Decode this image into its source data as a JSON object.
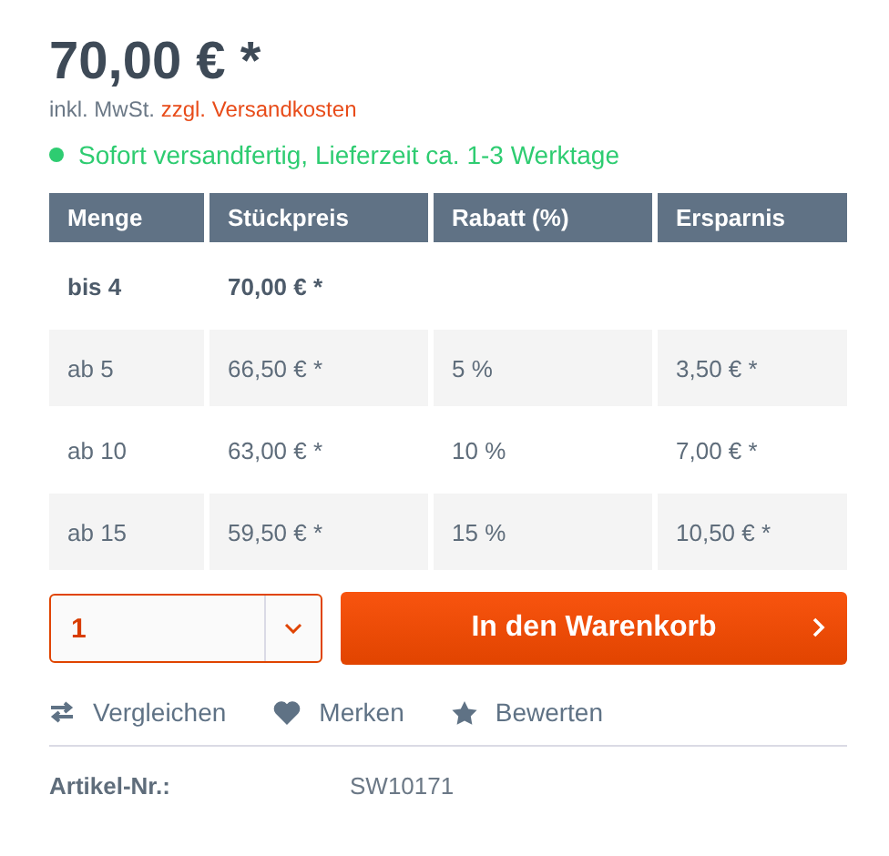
{
  "price": "70,00 € *",
  "tax_note": {
    "text": "inkl. MwSt.",
    "link": "zzgl. Versandkosten"
  },
  "delivery": {
    "text": "Sofort versandfertig, Lieferzeit ca. 1-3 Werktage",
    "color": "#2ecc71"
  },
  "table": {
    "columns": [
      "Menge",
      "Stückpreis",
      "Rabatt (%)",
      "Ersparnis"
    ],
    "rows": [
      {
        "current": true,
        "cells": [
          "bis 4",
          "70,00 € *"
        ]
      },
      {
        "current": false,
        "cells": [
          "ab 5",
          "66,50 € *",
          "5 %",
          "3,50 € *"
        ]
      },
      {
        "current": false,
        "cells": [
          "ab 10",
          "63,00 € *",
          "10 %",
          "7,00 € *"
        ]
      },
      {
        "current": false,
        "cells": [
          "ab 15",
          "59,50 € *",
          "15 %",
          "10,50 € *"
        ]
      }
    ]
  },
  "quantity": {
    "value": "1"
  },
  "cart_button": "In den Warenkorb",
  "actions": [
    {
      "kind": "compare",
      "label": "Vergleichen"
    },
    {
      "kind": "remember",
      "label": "Merken"
    },
    {
      "kind": "rate",
      "label": "Bewerten"
    }
  ],
  "article": {
    "label": "Artikel-Nr.:",
    "value": "SW10171"
  }
}
